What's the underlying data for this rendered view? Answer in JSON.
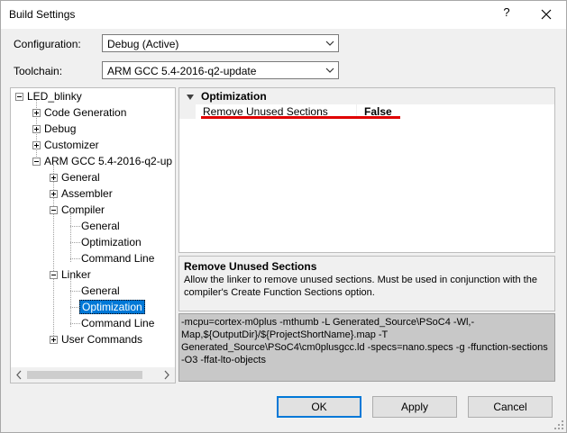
{
  "window": {
    "title": "Build Settings",
    "help_label": "?"
  },
  "configuration": {
    "label": "Configuration:",
    "value": "Debug (Active)"
  },
  "toolchain": {
    "label": "Toolchain:",
    "value": "ARM GCC 5.4-2016-q2-update"
  },
  "tree": {
    "nodes": [
      {
        "label": "LED_blinky"
      },
      {
        "label": "Code Generation"
      },
      {
        "label": "Debug"
      },
      {
        "label": "Customizer"
      },
      {
        "label": "ARM GCC 5.4-2016-q2-up"
      },
      {
        "label": "General"
      },
      {
        "label": "Assembler"
      },
      {
        "label": "Compiler"
      },
      {
        "label": "General"
      },
      {
        "label": "Optimization"
      },
      {
        "label": "Command Line"
      },
      {
        "label": "Linker"
      },
      {
        "label": "General"
      },
      {
        "label": "Optimization"
      },
      {
        "label": "Command Line"
      },
      {
        "label": "User Commands"
      }
    ],
    "selected": "Optimization"
  },
  "properties": {
    "category": "Optimization",
    "rows": [
      {
        "name": "Remove Unused Sections",
        "value": "False"
      }
    ]
  },
  "description": {
    "title": "Remove Unused Sections",
    "text": "Allow the linker to remove unused sections. Must be used in conjunction with the compiler's Create Function Sections option."
  },
  "command_line": {
    "text": "-mcpu=cortex-m0plus -mthumb -L Generated_Source\\PSoC4 -Wl,-Map,${OutputDir}/${ProjectShortName}.map -T Generated_Source\\PSoC4\\cm0plusgcc.ld -specs=nano.specs -g -ffunction-sections -O3 -ffat-lto-objects"
  },
  "buttons": {
    "ok": "OK",
    "apply": "Apply",
    "cancel": "Cancel"
  },
  "colors": {
    "selection": "#0078d7",
    "highlight_underline": "#e00000"
  }
}
